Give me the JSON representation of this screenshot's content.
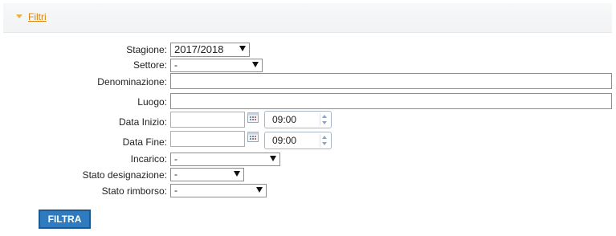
{
  "colors": {
    "accent": "#d6860f",
    "button": "#2f7bbf"
  },
  "header": {
    "link": "Filtri",
    "toggle_icon": "triangle-down-icon"
  },
  "form": {
    "stagione": {
      "label": "Stagione:",
      "value": "2017/2018"
    },
    "settore": {
      "label": "Settore:",
      "value": "-"
    },
    "denominazione": {
      "label": "Denominazione:",
      "value": ""
    },
    "luogo": {
      "label": "Luogo:",
      "value": ""
    },
    "data_inizio": {
      "label": "Data Inizio:",
      "date": "",
      "time": "09:00",
      "icon": "calendar-icon"
    },
    "data_fine": {
      "label": "Data Fine:",
      "date": "",
      "time": "09:00",
      "icon": "calendar-icon"
    },
    "incarico": {
      "label": "Incarico:",
      "value": "-"
    },
    "stato_designazione": {
      "label": "Stato designazione:",
      "value": "-"
    },
    "stato_rimborso": {
      "label": "Stato rimborso:",
      "value": "-"
    }
  },
  "button": {
    "filtra": "FILTRA"
  }
}
